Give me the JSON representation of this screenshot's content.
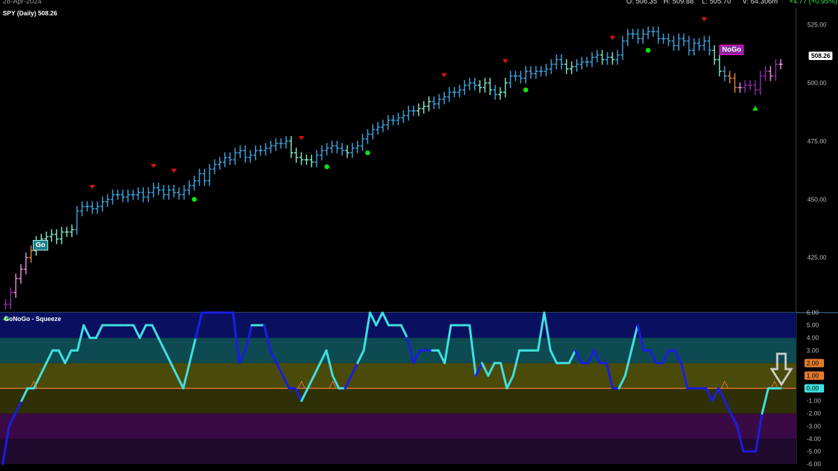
{
  "header": {
    "date": "28-Apr-2024",
    "open": "O: 506.35",
    "high": "H: 509.88",
    "low": "L: 505.70",
    "volume": "V: 64.306m",
    "change": "+4.77 (+0.95%)"
  },
  "price_pane": {
    "title": "SPY (Daily) 508.26",
    "last_price": "508.26",
    "go_label": "Go",
    "nogo_label": "NoGo"
  },
  "oscillator_pane": {
    "title": "GoNoGo - Squeeze"
  },
  "colors": {
    "background": "#000000",
    "strong_go": "#3a9fd8",
    "weak_go": "#7fe0c0",
    "go_fish": "#e07b2e",
    "weak_nogo": "#e08ad8",
    "strong_nogo": "#8a2aa0",
    "osc_cyan": "#3ee0e0",
    "osc_blue": "#1a1ee0",
    "zero_line": "#e07b2e",
    "sell_marker": "#e01010",
    "buy_marker": "#10e010"
  },
  "chart_data": [
    {
      "type": "ohlc",
      "title": "SPY (Daily) 508.26",
      "ylim": [
        402,
        532
      ],
      "y_ticks": [
        "525.00",
        "500.00",
        "475.00",
        "450.00",
        "425.00"
      ],
      "close_values": [
        405,
        410,
        416,
        420,
        425,
        428,
        432,
        433,
        434,
        435,
        433,
        436,
        436,
        437,
        445,
        447,
        447,
        446,
        447,
        449,
        450,
        452,
        452,
        451,
        452,
        452,
        453,
        451,
        453,
        455,
        454,
        452,
        454,
        453,
        452,
        454,
        456,
        458,
        461,
        458,
        463,
        465,
        466,
        468,
        467,
        470,
        471,
        468,
        469,
        471,
        471,
        472,
        473,
        474,
        474,
        475,
        470,
        468,
        467,
        467,
        466,
        469,
        471,
        472,
        473,
        472,
        471,
        470,
        472,
        473,
        476,
        478,
        480,
        481,
        482,
        484,
        484,
        485,
        486,
        488,
        488,
        489,
        490,
        492,
        491,
        493,
        494,
        496,
        496,
        497,
        499,
        500,
        499,
        498,
        500,
        497,
        495,
        496,
        500,
        503,
        503,
        502,
        505,
        504,
        505,
        505,
        506,
        508,
        510,
        508,
        506,
        507,
        508,
        509,
        509,
        511,
        512,
        510,
        511,
        510,
        512,
        518,
        521,
        521,
        519,
        521,
        522,
        522,
        519,
        519,
        518,
        516,
        519,
        518,
        514,
        517,
        516,
        518,
        514,
        510,
        505,
        503,
        502,
        498,
        498,
        499,
        499,
        497,
        503,
        505,
        503,
        508,
        508
      ],
      "bar_colors": [
        "nogo",
        "nogo",
        "wnogo",
        "wnogo",
        "wnogo",
        "fish",
        "wgo",
        "wgo",
        "wgo",
        "wgo",
        "wgo",
        "wgo",
        "wgo",
        "wgo",
        "go",
        "go",
        "go",
        "go",
        "go",
        "go",
        "go",
        "go",
        "go",
        "go",
        "go",
        "go",
        "go",
        "go",
        "go",
        "go",
        "go",
        "go",
        "go",
        "go",
        "go",
        "go",
        "go",
        "go",
        "go",
        "go",
        "go",
        "go",
        "go",
        "go",
        "go",
        "go",
        "go",
        "go",
        "go",
        "go",
        "go",
        "go",
        "go",
        "go",
        "go",
        "go",
        "wgo",
        "wgo",
        "wgo",
        "wgo",
        "wgo",
        "go",
        "go",
        "go",
        "go",
        "go",
        "go",
        "wgo",
        "go",
        "go",
        "go",
        "go",
        "go",
        "go",
        "go",
        "go",
        "go",
        "go",
        "go",
        "go",
        "go",
        "wgo",
        "wgo",
        "wgo",
        "go",
        "go",
        "go",
        "go",
        "go",
        "go",
        "go",
        "go",
        "go",
        "wgo",
        "wgo",
        "wgo",
        "go",
        "wgo",
        "wgo",
        "go",
        "go",
        "go",
        "go",
        "go",
        "go",
        "go",
        "go",
        "go",
        "go",
        "go",
        "wgo",
        "wgo",
        "go",
        "go",
        "go",
        "go",
        "go",
        "wgo",
        "go",
        "wgo",
        "go",
        "go",
        "go",
        "go",
        "go",
        "go",
        "go",
        "go",
        "go",
        "go",
        "go",
        "go",
        "go",
        "go",
        "go",
        "go",
        "go",
        "go",
        "go",
        "wgo",
        "wgo",
        "go",
        "fish",
        "fish",
        "wnogo",
        "nogo",
        "nogo",
        "nogo",
        "nogo",
        "nogo",
        "wnogo",
        "nogo",
        "wnogo",
        "wnogo",
        "wnogo",
        "nogo",
        "wnogo"
      ]
    },
    {
      "type": "line",
      "title": "GoNoGo - Squeeze",
      "ylim": [
        -6,
        6
      ],
      "y_ticks": [
        "6.00",
        "5.00",
        "4.00",
        "3.00",
        "2.00",
        "1.00",
        "0.00",
        "-1.00",
        "-2.00",
        "-3.00",
        "-4.00",
        "-5.00",
        "-6.00"
      ],
      "highlighted_ticks": [
        "2.00",
        "1.00",
        "0.00"
      ],
      "values": [
        -6,
        -3,
        -2,
        -1,
        0,
        0,
        1,
        2,
        3,
        3,
        2,
        3,
        3,
        5,
        4,
        4,
        5,
        5,
        5,
        5,
        5,
        5,
        4,
        5,
        5,
        4,
        3,
        2,
        1,
        0,
        2,
        4,
        6,
        6,
        6,
        6,
        6,
        6,
        2,
        3,
        5,
        5,
        5,
        3,
        2,
        1,
        0,
        0,
        -1,
        0,
        1,
        2,
        3,
        1,
        0,
        0,
        1,
        2,
        3,
        6,
        5,
        6,
        5,
        5,
        5,
        4,
        2,
        3,
        3,
        3,
        3,
        2,
        5,
        5,
        5,
        5,
        1,
        2,
        1,
        2,
        2,
        0,
        1,
        3,
        3,
        3,
        3,
        6,
        3,
        2,
        2,
        2,
        3,
        2,
        2,
        3,
        2,
        2,
        0,
        0,
        1,
        3,
        5,
        3,
        3,
        2,
        2,
        3,
        3,
        2,
        0,
        0,
        0,
        0,
        -1,
        0,
        -1,
        -2,
        -3,
        -5,
        -5,
        -5,
        -2,
        0,
        0,
        0
      ],
      "line_colors": [
        "blue",
        "blue",
        "blue",
        "blue",
        "cyan",
        "cyan",
        "cyan",
        "cyan",
        "cyan",
        "cyan",
        "cyan",
        "cyan",
        "cyan",
        "cyan",
        "cyan",
        "cyan",
        "cyan",
        "cyan",
        "cyan",
        "cyan",
        "cyan",
        "cyan",
        "cyan",
        "cyan",
        "cyan",
        "cyan",
        "cyan",
        "cyan",
        "cyan",
        "cyan",
        "cyan",
        "cyan",
        "blue",
        "blue",
        "blue",
        "blue",
        "blue",
        "blue",
        "blue",
        "blue",
        "blue",
        "cyan",
        "cyan",
        "blue",
        "blue",
        "blue",
        "blue",
        "blue",
        "blue",
        "cyan",
        "cyan",
        "cyan",
        "cyan",
        "cyan",
        "cyan",
        "cyan",
        "blue",
        "blue",
        "cyan",
        "cyan",
        "cyan",
        "cyan",
        "cyan",
        "cyan",
        "cyan",
        "cyan",
        "blue",
        "blue",
        "blue",
        "blue",
        "cyan",
        "cyan",
        "cyan",
        "cyan",
        "cyan",
        "cyan",
        "cyan",
        "blue",
        "cyan",
        "cyan",
        "cyan",
        "cyan",
        "cyan",
        "cyan",
        "cyan",
        "cyan",
        "cyan",
        "cyan",
        "cyan",
        "cyan",
        "cyan",
        "cyan",
        "cyan",
        "blue",
        "blue",
        "blue",
        "blue",
        "blue",
        "blue",
        "blue",
        "cyan",
        "cyan",
        "cyan",
        "blue",
        "blue",
        "blue",
        "blue",
        "blue",
        "blue",
        "blue",
        "blue",
        "blue",
        "blue",
        "blue",
        "blue",
        "blue",
        "blue",
        "blue",
        "blue",
        "blue",
        "blue",
        "blue",
        "blue",
        "cyan",
        "cyan",
        "cyan"
      ]
    }
  ]
}
